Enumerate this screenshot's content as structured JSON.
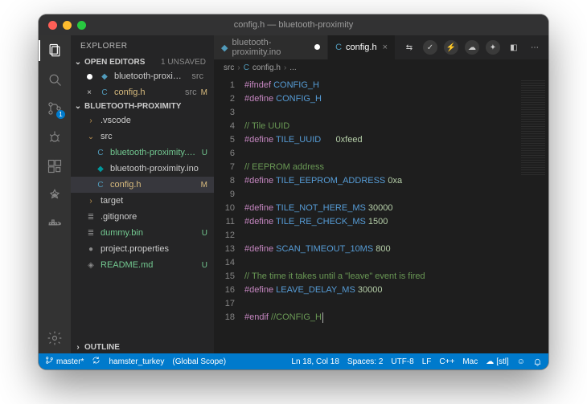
{
  "window": {
    "title": "config.h — bluetooth-proximity"
  },
  "activity": {
    "scm_badge": "1"
  },
  "sidebar": {
    "title": "EXPLORER",
    "open_editors": {
      "label": "OPEN EDITORS",
      "unsaved": "1 UNSAVED",
      "items": [
        {
          "icon": "dot",
          "name": "bluetooth-proximity.ino",
          "hint": "src",
          "status": ""
        },
        {
          "icon": "close",
          "name": "config.h",
          "hint": "src",
          "status": "M"
        }
      ]
    },
    "folder": {
      "label": "BLUETOOTH-PROXIMITY",
      "rows": [
        {
          "depth": 1,
          "kind": "folder-closed",
          "name": ".vscode",
          "status": ""
        },
        {
          "depth": 1,
          "kind": "folder-open",
          "name": "src",
          "status": ""
        },
        {
          "depth": 2,
          "kind": "cpp",
          "name": "bluetooth-proximity.cpp",
          "status": "U",
          "git": "u"
        },
        {
          "depth": 2,
          "kind": "ino",
          "name": "bluetooth-proximity.ino",
          "status": "",
          "git": ""
        },
        {
          "depth": 2,
          "kind": "c",
          "name": "config.h",
          "status": "M",
          "git": "m",
          "selected": true
        },
        {
          "depth": 1,
          "kind": "folder-closed",
          "name": "target",
          "status": ""
        },
        {
          "depth": 1,
          "kind": "txt",
          "name": ".gitignore",
          "status": ""
        },
        {
          "depth": 1,
          "kind": "txt",
          "name": "dummy.bin",
          "status": "U",
          "git": "u"
        },
        {
          "depth": 1,
          "kind": "json",
          "name": "project.properties",
          "status": ""
        },
        {
          "depth": 1,
          "kind": "md",
          "name": "README.md",
          "status": "U",
          "git": "u"
        }
      ]
    },
    "outline": {
      "label": "OUTLINE"
    }
  },
  "tabs": {
    "items": [
      {
        "name": "bluetooth-proximity.ino",
        "active": false,
        "dirty": true
      },
      {
        "name": "config.h",
        "active": true,
        "dirty": false
      }
    ]
  },
  "breadcrumbs": {
    "a": "src",
    "b": "config.h",
    "c": "..."
  },
  "code": {
    "lines": [
      {
        "n": 1,
        "seg": [
          [
            "kw",
            "#ifndef "
          ],
          [
            "mc",
            "CONFIG_H"
          ]
        ]
      },
      {
        "n": 2,
        "seg": [
          [
            "kw",
            "#define "
          ],
          [
            "mc",
            "CONFIG_H"
          ]
        ]
      },
      {
        "n": 3,
        "seg": [
          [
            "",
            ""
          ]
        ]
      },
      {
        "n": 4,
        "seg": [
          [
            "cm",
            "// Tile UUID"
          ]
        ]
      },
      {
        "n": 5,
        "seg": [
          [
            "kw",
            "#define "
          ],
          [
            "mc",
            "TILE_UUID"
          ],
          [
            "",
            "      "
          ],
          [
            "num",
            "0xfeed"
          ]
        ]
      },
      {
        "n": 6,
        "seg": [
          [
            "",
            ""
          ]
        ]
      },
      {
        "n": 7,
        "seg": [
          [
            "cm",
            "// EEPROM address"
          ]
        ]
      },
      {
        "n": 8,
        "seg": [
          [
            "kw",
            "#define "
          ],
          [
            "mc",
            "TILE_EEPROM_ADDRESS"
          ],
          [
            "",
            " "
          ],
          [
            "num",
            "0xa"
          ]
        ]
      },
      {
        "n": 9,
        "seg": [
          [
            "",
            ""
          ]
        ]
      },
      {
        "n": 10,
        "seg": [
          [
            "kw",
            "#define "
          ],
          [
            "mc",
            "TILE_NOT_HERE_MS"
          ],
          [
            "",
            " "
          ],
          [
            "num",
            "30000"
          ]
        ]
      },
      {
        "n": 11,
        "seg": [
          [
            "kw",
            "#define "
          ],
          [
            "mc",
            "TILE_RE_CHECK_MS"
          ],
          [
            "",
            " "
          ],
          [
            "num",
            "1500"
          ]
        ]
      },
      {
        "n": 12,
        "seg": [
          [
            "",
            ""
          ]
        ]
      },
      {
        "n": 13,
        "seg": [
          [
            "kw",
            "#define "
          ],
          [
            "mc",
            "SCAN_TIMEOUT_10MS"
          ],
          [
            "",
            " "
          ],
          [
            "num",
            "800"
          ]
        ]
      },
      {
        "n": 14,
        "seg": [
          [
            "",
            ""
          ]
        ]
      },
      {
        "n": 15,
        "seg": [
          [
            "cm",
            "// The time it takes until a \"leave\" event is fired"
          ]
        ]
      },
      {
        "n": 16,
        "seg": [
          [
            "kw",
            "#define "
          ],
          [
            "mc",
            "LEAVE_DELAY_MS"
          ],
          [
            "",
            " "
          ],
          [
            "num",
            "30000"
          ]
        ]
      },
      {
        "n": 17,
        "seg": [
          [
            "",
            ""
          ]
        ]
      },
      {
        "n": 18,
        "seg": [
          [
            "kw",
            "#endif "
          ],
          [
            "cm",
            "//CONFIG_H"
          ]
        ]
      }
    ]
  },
  "status": {
    "branch": "master*",
    "ctx1": "hamster_turkey",
    "ctx2": "(Global Scope)",
    "pos": "Ln 18, Col 18",
    "spaces": "Spaces: 2",
    "enc": "UTF-8",
    "eol": "LF",
    "lang": "C++",
    "os": "Mac",
    "cloud": "[stl]"
  }
}
